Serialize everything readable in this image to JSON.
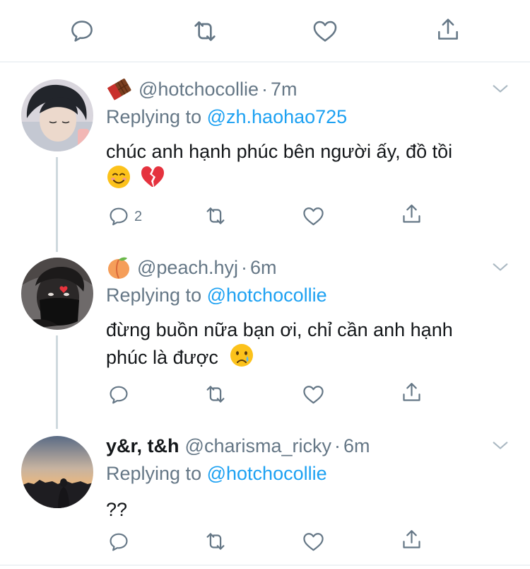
{
  "tweets": [
    {
      "display_name": "",
      "name_emoji": "chocolate-bar",
      "handle": "@hotchocollie",
      "dot": "·",
      "time": "7m",
      "replying_prefix": "Replying to",
      "replying_to": "@zh.haohao725",
      "text_line1": "chúc anh hạnh phúc bên người ấy, đồ tồi",
      "text_line2": "",
      "reply_count": "2"
    },
    {
      "display_name": "",
      "name_emoji": "peach",
      "handle": "@peach.hyj",
      "dot": "·",
      "time": "6m",
      "replying_prefix": "Replying to",
      "replying_to": "@hotchocollie",
      "text_line1": "đừng buồn nữa bạn ơi, chỉ cần anh hạnh",
      "text_line2": "phúc là được",
      "reply_count": ""
    },
    {
      "display_name": "y&r, t&h",
      "name_emoji": "",
      "handle": "@charisma_ricky",
      "dot": "·",
      "time": "6m",
      "replying_prefix": "Replying to",
      "replying_to": "@hotchocollie",
      "text_line1": "??",
      "text_line2": "",
      "reply_count": ""
    }
  ],
  "icons": {
    "reply": "reply-icon",
    "retweet": "retweet-icon",
    "like": "like-icon",
    "share": "share-icon",
    "more": "chevron-down-icon"
  },
  "colors": {
    "text": "#14171a",
    "secondary": "#657786",
    "link": "#1da1f2",
    "divider": "#e1e8ed",
    "thread_line": "#cfd9de"
  }
}
